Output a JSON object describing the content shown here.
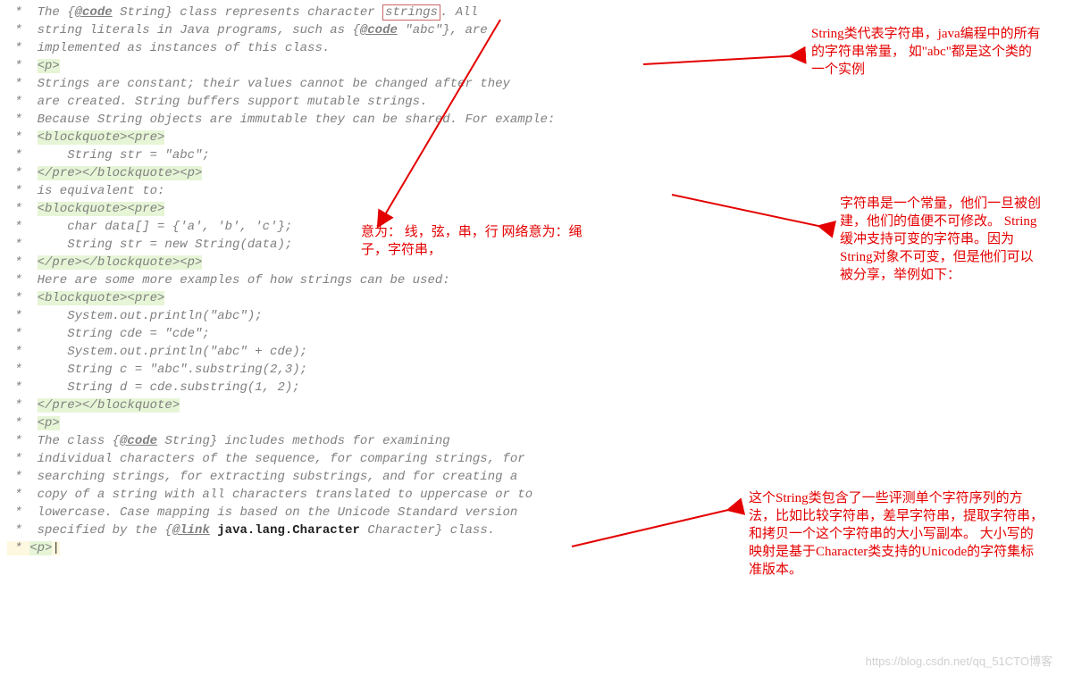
{
  "code": {
    "lines": [
      {
        "pre": " *  The {",
        "kw": "@code",
        "post1": " String} class represents character ",
        "box": "strings",
        "post2": ". All"
      },
      {
        "pre": " *  string literals in Java programs, such as {",
        "kw": "@code",
        "post1": " \"abc\"}, are"
      },
      {
        "text": " *  implemented as instances of this class."
      },
      {
        "star": " *  ",
        "tag": "<p>"
      },
      {
        "text": " *  Strings are constant; their values cannot be changed after they"
      },
      {
        "text": " *  are created. String buffers support mutable strings."
      },
      {
        "text": " *  Because String objects are immutable they can be shared. For example:"
      },
      {
        "star": " *  ",
        "tag": "<blockquote><pre>"
      },
      {
        "text": " *      String str = \"abc\";"
      },
      {
        "star": " *  ",
        "tag": "</pre></blockquote><p>"
      },
      {
        "text": " *  is equivalent to:"
      },
      {
        "star": " *  ",
        "tag": "<blockquote><pre>"
      },
      {
        "text": " *      char data[] = {'a', 'b', 'c'};"
      },
      {
        "text": " *      String str = new String(data);"
      },
      {
        "star": " *  ",
        "tag": "</pre></blockquote><p>"
      },
      {
        "text": " *  Here are some more examples of how strings can be used:"
      },
      {
        "star": " *  ",
        "tag": "<blockquote><pre>"
      },
      {
        "text": " *      System.out.println(\"abc\");"
      },
      {
        "text": " *      String cde = \"cde\";"
      },
      {
        "text": " *      System.out.println(\"abc\" + cde);"
      },
      {
        "text": " *      String c = \"abc\".substring(2,3);"
      },
      {
        "text": " *      String d = cde.substring(1, 2);"
      },
      {
        "star": " *  ",
        "tag": "</pre></blockquote>"
      },
      {
        "star": " *  ",
        "tag": "<p>"
      },
      {
        "pre": " *  The class {",
        "kw": "@code",
        "post1": " String} includes methods for examining"
      },
      {
        "text": " *  individual characters of the sequence, for comparing strings, for"
      },
      {
        "text": " *  searching strings, for extracting substrings, and for creating a"
      },
      {
        "text": " *  copy of a string with all characters translated to uppercase or to"
      },
      {
        "text": " *  lowercase. Case mapping is based on the Unicode Standard version"
      },
      {
        "pre": " *  specified by the {",
        "kw": "@link",
        "post1": " ",
        "pkg": "java.lang.Character",
        "post2": " Character} class."
      },
      {
        "star": " * ",
        "tag": "<p>",
        "cursor": true
      }
    ]
  },
  "annotations": {
    "a1": "String类代表字符串，java编程中的所有的字符串常量，\n如\"abc\"都是这个类的一个实例",
    "a2": "意为： 线，弦，串，行\n网络意为：绳子，字符串，",
    "a3": "字符串是一个常量，他们一旦被创建，他们的值便不可修改。 String缓冲支持可变的字符串。因为String对象不可变，但是他们可以被分享，举例如下：",
    "a4": "这个String类包含了一些评测单个字符序列的方法，比如比较字符串，差早字符串，提取字符串，和拷贝一个这个字符串的大小写副本。  大小写的映射是基于Character类支持的Unicode的字符集标准版本。"
  },
  "watermark": "https://blog.csdn.net/qq_51CTO博客"
}
